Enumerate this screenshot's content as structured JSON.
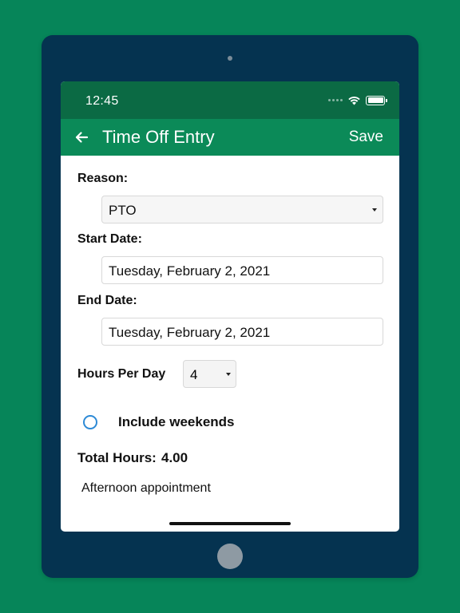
{
  "status_bar": {
    "time": "12:45"
  },
  "app_bar": {
    "title": "Time Off Entry",
    "save_label": "Save"
  },
  "form": {
    "reason_label": "Reason:",
    "reason_value": "PTO",
    "start_date_label": "Start Date:",
    "start_date_value": "Tuesday, February 2, 2021",
    "end_date_label": "End Date:",
    "end_date_value": "Tuesday, February 2, 2021",
    "hours_per_day_label": "Hours Per Day",
    "hours_per_day_value": "4",
    "include_weekends_label": "Include weekends",
    "include_weekends_checked": false,
    "total_hours_label": "Total Hours:",
    "total_hours_value": "4.00",
    "note": "Afternoon appointment"
  },
  "colors": {
    "background": "#068559",
    "device_frame": "#053350",
    "status_bar": "#0b6a44",
    "app_bar": "#0b8a58",
    "radio_accent": "#2d8ad6"
  }
}
